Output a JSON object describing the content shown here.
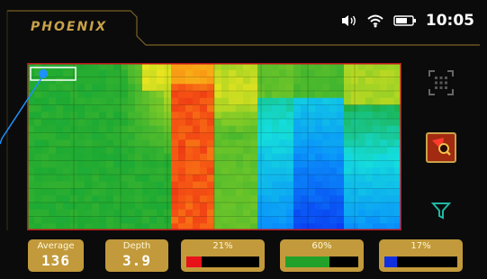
{
  "brand": "PHOENIX",
  "status": {
    "time": "10:05",
    "icons": [
      "vibrate-icon",
      "wifi-icon",
      "battery-icon"
    ]
  },
  "side_buttons": [
    "grid-select-icon",
    "search-target-icon",
    "filter-icon"
  ],
  "stats": {
    "average": {
      "label": "Average",
      "value": "136"
    },
    "depth": {
      "label": "Depth",
      "value": "3.9"
    }
  },
  "distribution": [
    {
      "label": "21%",
      "fraction": 0.21,
      "color": "#e8121a"
    },
    {
      "label": "60%",
      "fraction": 0.6,
      "color": "#22a12a"
    },
    {
      "label": "17%",
      "fraction": 0.17,
      "color": "#1030e0"
    }
  ],
  "colors": {
    "accent": "#c9a24a",
    "grid_border": "#c0141c",
    "selection": "#ffffff"
  }
}
